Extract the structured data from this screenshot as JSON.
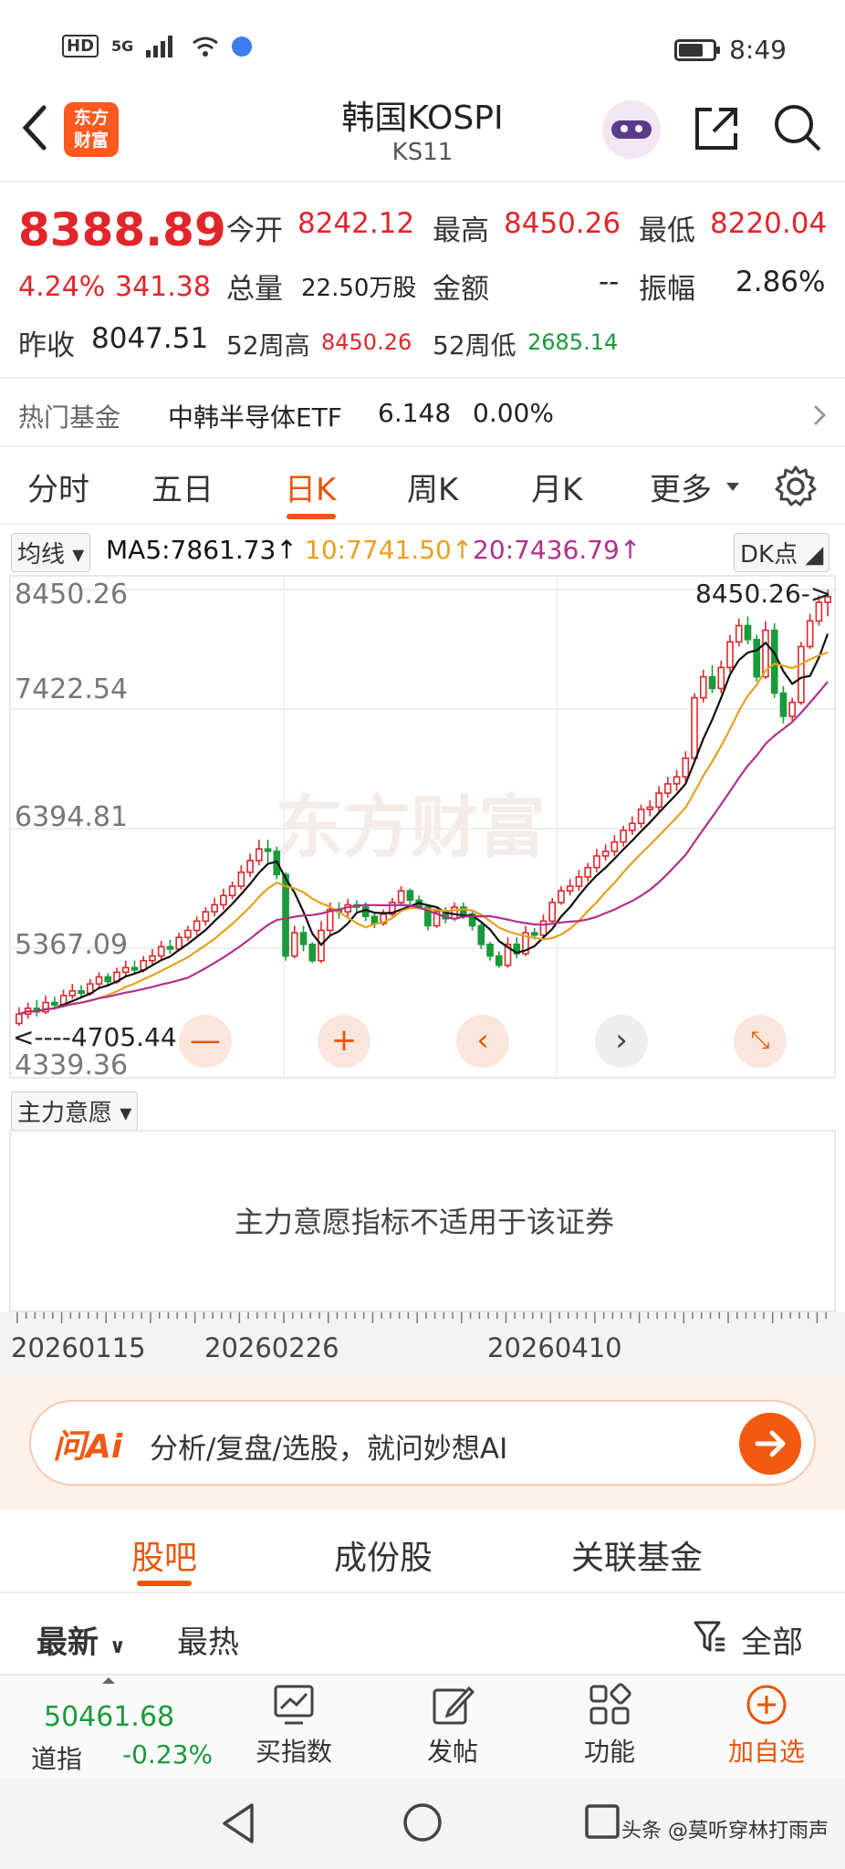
{
  "status_bar": {
    "left_icons": "HD",
    "net": "5G",
    "time": "8:49"
  },
  "header": {
    "logo_line1": "东方",
    "logo_line2": "财富",
    "title": "韩国KOSPI",
    "code": "KS11"
  },
  "quote": {
    "price": "8388.89",
    "change_pct": "4.24%",
    "change_abs": "341.38",
    "prev_close_label": "昨收",
    "prev_close": "8047.51",
    "open_label": "今开",
    "open": "8242.12",
    "high_label": "最高",
    "high": "8450.26",
    "low_label": "最低",
    "low": "8220.04",
    "volume_label": "总量",
    "volume": "22.50万股",
    "amount_label": "金额",
    "amount": "--",
    "amplitude_label": "振幅",
    "amplitude": "2.86%",
    "wk52_high_label": "52周高",
    "wk52_high": "8450.26",
    "wk52_low_label": "52周低",
    "wk52_low": "2685.14"
  },
  "fund": {
    "label": "热门基金",
    "name": "中韩半导体ETF",
    "price": "6.148",
    "change": "0.00%"
  },
  "chart_tabs": [
    "分时",
    "五日",
    "日K",
    "周K",
    "月K",
    "更多"
  ],
  "ma": {
    "select": "均线",
    "ma5": "MA5:7861.73",
    "ma10": "10:7741.50",
    "ma20": "20:7436.79",
    "dk": "DK点"
  },
  "chart_labels": {
    "y_ticks": [
      "8450.26",
      "7422.54",
      "6394.81",
      "5367.09",
      "4339.36"
    ],
    "max_marker": "8450.26->",
    "min_marker": "<----4705.44"
  },
  "indicator": {
    "select": "主力意愿",
    "message": "主力意愿指标不适用于该证券"
  },
  "dates": [
    "20260115",
    "20260226",
    "20260410"
  ],
  "ai": {
    "logo": "问Ai",
    "placeholder": "分析/复盘/选股，就问妙想AI"
  },
  "bottom_tabs": [
    "股吧",
    "成份股",
    "关联基金"
  ],
  "sort": {
    "latest": "最新",
    "hot": "最热",
    "filter": "全部"
  },
  "nav": {
    "index_value": "50461.68",
    "index_name": "道指",
    "index_change": "-0.23%",
    "buy_index": "买指数",
    "post": "发帖",
    "func": "功能",
    "add_fav": "加自选"
  },
  "watermark": "头条 @莫听穿林打雨声",
  "colors": {
    "up": "#e0262b",
    "down": "#1a9a3a",
    "accent": "#e8560c",
    "ma5": "#111111",
    "ma10": "#e8a020",
    "ma20": "#b0308a"
  },
  "chart_data": {
    "type": "candlestick",
    "y_range": [
      4339.36,
      8450.26
    ],
    "high_marker": 8450.26,
    "low_marker": 4705.44,
    "x_dates_labeled": [
      "20260115",
      "20260226",
      "20260410"
    ],
    "candles": [
      [
        4720,
        4800,
        4700,
        4860
      ],
      [
        4800,
        4850,
        4760,
        4900
      ],
      [
        4850,
        4820,
        4780,
        4920
      ],
      [
        4820,
        4900,
        4800,
        4960
      ],
      [
        4900,
        4880,
        4840,
        4950
      ],
      [
        4880,
        4960,
        4860,
        5010
      ],
      [
        4960,
        5000,
        4930,
        5060
      ],
      [
        5000,
        4980,
        4950,
        5050
      ],
      [
        4980,
        5060,
        4960,
        5100
      ],
      [
        5060,
        5120,
        5030,
        5160
      ],
      [
        5120,
        5080,
        5040,
        5150
      ],
      [
        5080,
        5160,
        5060,
        5200
      ],
      [
        5160,
        5200,
        5120,
        5260
      ],
      [
        5200,
        5180,
        5150,
        5260
      ],
      [
        5180,
        5260,
        5160,
        5300
      ],
      [
        5260,
        5300,
        5230,
        5360
      ],
      [
        5300,
        5380,
        5270,
        5430
      ],
      [
        5380,
        5360,
        5320,
        5440
      ],
      [
        5360,
        5460,
        5340,
        5500
      ],
      [
        5460,
        5520,
        5430,
        5560
      ],
      [
        5520,
        5600,
        5480,
        5640
      ],
      [
        5600,
        5680,
        5560,
        5720
      ],
      [
        5680,
        5740,
        5640,
        5800
      ],
      [
        5740,
        5820,
        5700,
        5880
      ],
      [
        5820,
        5900,
        5790,
        5940
      ],
      [
        5900,
        6020,
        5870,
        6080
      ],
      [
        6020,
        6120,
        5980,
        6180
      ],
      [
        6120,
        6220,
        6080,
        6300
      ],
      [
        6220,
        6200,
        6100,
        6300
      ],
      [
        6200,
        6000,
        5960,
        6240
      ],
      [
        6000,
        5300,
        5260,
        6020
      ],
      [
        5300,
        5500,
        5280,
        5560
      ],
      [
        5500,
        5400,
        5340,
        5560
      ],
      [
        5400,
        5260,
        5240,
        5420
      ],
      [
        5260,
        5520,
        5240,
        5600
      ],
      [
        5520,
        5700,
        5480,
        5760
      ],
      [
        5700,
        5680,
        5620,
        5760
      ],
      [
        5680,
        5740,
        5640,
        5790
      ],
      [
        5740,
        5720,
        5680,
        5780
      ],
      [
        5720,
        5640,
        5600,
        5760
      ],
      [
        5640,
        5580,
        5540,
        5680
      ],
      [
        5580,
        5660,
        5560,
        5700
      ],
      [
        5660,
        5760,
        5640,
        5800
      ],
      [
        5760,
        5860,
        5740,
        5900
      ],
      [
        5860,
        5780,
        5740,
        5880
      ],
      [
        5780,
        5720,
        5700,
        5820
      ],
      [
        5720,
        5560,
        5520,
        5740
      ],
      [
        5560,
        5680,
        5540,
        5720
      ],
      [
        5680,
        5620,
        5580,
        5720
      ],
      [
        5620,
        5720,
        5600,
        5760
      ],
      [
        5720,
        5660,
        5620,
        5760
      ],
      [
        5660,
        5560,
        5520,
        5700
      ],
      [
        5560,
        5400,
        5360,
        5580
      ],
      [
        5400,
        5300,
        5260,
        5420
      ],
      [
        5300,
        5220,
        5200,
        5340
      ],
      [
        5220,
        5400,
        5200,
        5460
      ],
      [
        5400,
        5320,
        5280,
        5460
      ],
      [
        5320,
        5500,
        5300,
        5560
      ],
      [
        5500,
        5480,
        5440,
        5540
      ],
      [
        5480,
        5600,
        5460,
        5660
      ],
      [
        5600,
        5760,
        5580,
        5800
      ],
      [
        5760,
        5860,
        5740,
        5900
      ],
      [
        5860,
        5900,
        5820,
        5960
      ],
      [
        5900,
        5980,
        5860,
        6040
      ],
      [
        5980,
        6060,
        5940,
        6100
      ],
      [
        6060,
        6160,
        6020,
        6220
      ],
      [
        6160,
        6200,
        6120,
        6260
      ],
      [
        6200,
        6280,
        6160,
        6340
      ],
      [
        6280,
        6380,
        6240,
        6420
      ],
      [
        6380,
        6440,
        6340,
        6500
      ],
      [
        6440,
        6560,
        6400,
        6600
      ],
      [
        6560,
        6580,
        6500,
        6640
      ],
      [
        6580,
        6700,
        6540,
        6760
      ],
      [
        6700,
        6780,
        6660,
        6840
      ],
      [
        6780,
        6840,
        6720,
        6900
      ],
      [
        6840,
        7000,
        6800,
        7060
      ],
      [
        7000,
        7520,
        6980,
        7560
      ],
      [
        7520,
        7700,
        7480,
        7760
      ],
      [
        7700,
        7600,
        7560,
        7800
      ],
      [
        7600,
        7780,
        7560,
        7840
      ],
      [
        7780,
        8000,
        7740,
        8060
      ],
      [
        8000,
        8140,
        7960,
        8200
      ],
      [
        8140,
        8020,
        7980,
        8220
      ],
      [
        8020,
        7700,
        7660,
        8060
      ],
      [
        7700,
        8100,
        7680,
        8180
      ],
      [
        8100,
        7560,
        7520,
        8160
      ],
      [
        7560,
        7360,
        7300,
        7620
      ],
      [
        7360,
        7480,
        7320,
        7520
      ],
      [
        7480,
        7960,
        7460,
        8000
      ],
      [
        7960,
        8180,
        7940,
        8240
      ],
      [
        8180,
        8340,
        8140,
        8400
      ],
      [
        8340,
        8388.89,
        8220.04,
        8450.26
      ]
    ]
  }
}
